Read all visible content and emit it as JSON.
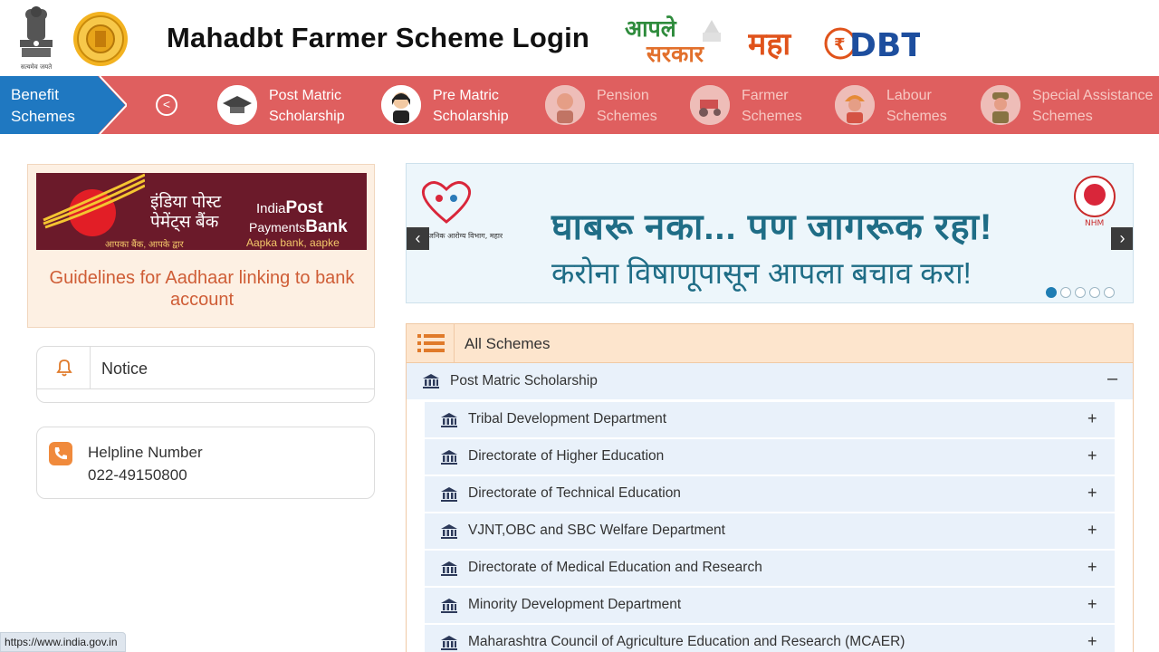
{
  "header": {
    "title": "Mahadbt Farmer Scheme Login",
    "emblem_caption": "सत्यमेव जयते",
    "aaple_line1": "आपले",
    "aaple_line2": "सरकार",
    "maha_text": "महा",
    "dbt_text": "DBT"
  },
  "nav": {
    "benefit_label": "Benefit Schemes",
    "back_icon": "chevron-left-circle-icon",
    "items": [
      {
        "label_line1": "Post Matric",
        "label_line2": "Scholarship",
        "icon": "graduation-cap-icon",
        "active": true
      },
      {
        "label_line1": "Pre Matric",
        "label_line2": "Scholarship",
        "icon": "student-girl-icon",
        "active": true
      },
      {
        "label_line1": "Pension",
        "label_line2": "Schemes",
        "icon": "elderly-man-icon",
        "active": false
      },
      {
        "label_line1": "Farmer",
        "label_line2": "Schemes",
        "icon": "tractor-icon",
        "active": false
      },
      {
        "label_line1": "Labour",
        "label_line2": "Schemes",
        "icon": "worker-helmet-icon",
        "active": false
      },
      {
        "label_line1": "Special Assistance",
        "label_line2": "Schemes",
        "icon": "soldier-icon",
        "active": false
      }
    ]
  },
  "bank_card": {
    "hindi_line1": "इंडिया पोस्ट",
    "hindi_line2": "पेमेंट्स बैंक",
    "en_india": "India",
    "en_post": "Post",
    "en_payments": "Payments",
    "en_bank": "Bank",
    "tag_hindi": "आपका बैंक, आपके द्वार",
    "tag_en": "Aapka bank, aapke dwaar",
    "caption": "Guidelines for Aadhaar linking to bank account"
  },
  "notice": {
    "label": "Notice",
    "icon": "bell-icon"
  },
  "helpline": {
    "label": "Helpline Number",
    "number": "022-49150800",
    "icon": "phone-icon"
  },
  "carousel": {
    "line1": "घाबरू नका... पण जागरूक रहा!",
    "line2": "करोना विषाणूपासून आपला बचाव करा!",
    "left_logo_caption": "सार्वजनिक आरोग्य विभाग, महाराष्ट्र शासन",
    "right_logo_caption": "NHM",
    "slide_count": 5,
    "active_slide": 1
  },
  "schemes": {
    "title": "All Schemes",
    "group": {
      "label": "Post Matric Scholarship",
      "toggle": "–"
    },
    "departments": [
      {
        "label": "Tribal Development Department",
        "toggle": "+"
      },
      {
        "label": "Directorate of Higher Education",
        "toggle": "+"
      },
      {
        "label": "Directorate of Technical Education",
        "toggle": "+"
      },
      {
        "label": "VJNT,OBC and SBC Welfare Department",
        "toggle": "+"
      },
      {
        "label": "Directorate of Medical Education and Research",
        "toggle": "+"
      },
      {
        "label": "Minority Development Department",
        "toggle": "+"
      },
      {
        "label": "Maharashtra Council of Agriculture Education and Research (MCAER)",
        "toggle": "+"
      }
    ]
  },
  "status_bar": {
    "url": "https://www.india.gov.in"
  },
  "colors": {
    "nav_bg": "#df5f5f",
    "benefit_bg": "#1f78c1",
    "caption_orange": "#cf5d36",
    "carousel_text": "#1f6d86",
    "scheme_header_bg": "#fde5cd",
    "row_bg": "#e9f1fa"
  }
}
